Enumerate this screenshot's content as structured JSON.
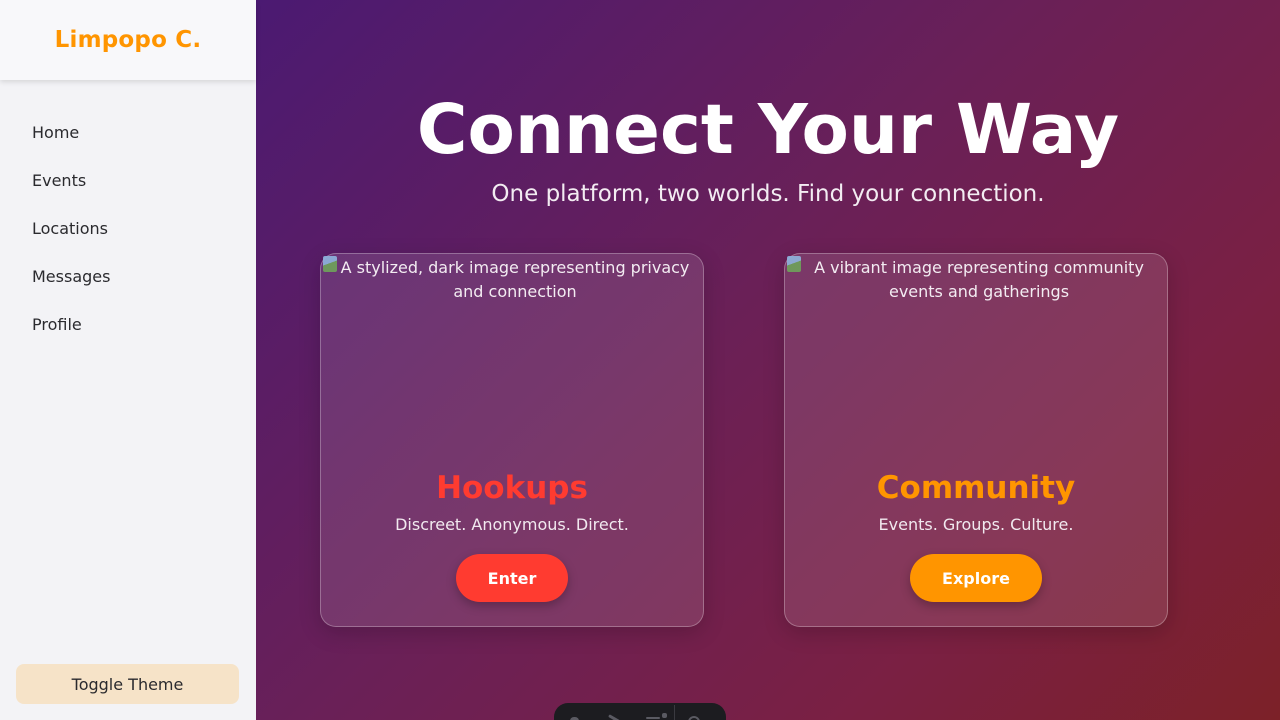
{
  "sidebar": {
    "brand": "Limpopo C.",
    "nav": [
      "Home",
      "Events",
      "Locations",
      "Messages",
      "Profile"
    ],
    "toggle_label": "Toggle Theme"
  },
  "hero": {
    "title": "Connect Your Way",
    "subtitle": "One platform, two worlds. Find your connection."
  },
  "cards": [
    {
      "image_alt": "A stylized, dark image representing privacy and connection",
      "title": "Hookups",
      "description": "Discreet. Anonymous. Direct.",
      "button": "Enter",
      "accent": "#ff3b30"
    },
    {
      "image_alt": "A vibrant image representing community events and gatherings",
      "title": "Community",
      "description": "Events. Groups. Culture.",
      "button": "Explore",
      "accent": "#ff9500"
    }
  ],
  "colors": {
    "brand": "#ff9500",
    "gradient_start": "#4b1a72",
    "gradient_end": "#7c2128"
  },
  "toolbar": {
    "icons": [
      "inspect-icon",
      "tools-icon",
      "menu-icon",
      "settings-icon"
    ]
  }
}
